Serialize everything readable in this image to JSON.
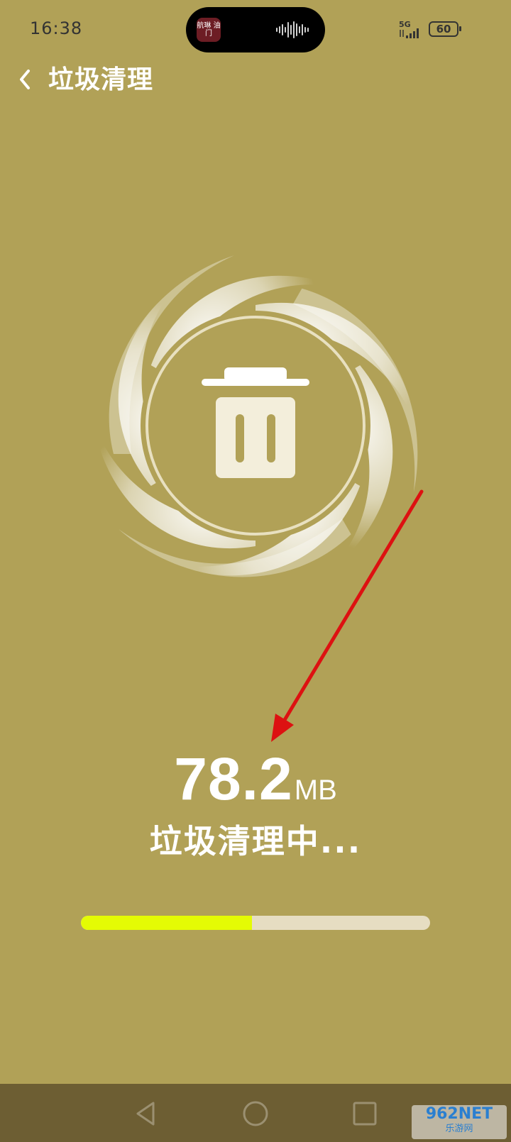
{
  "status_bar": {
    "time": "16:38",
    "network": "5G",
    "battery": "60",
    "island_app_label": "航琳 油门"
  },
  "header": {
    "back_icon": "chevron-left-icon",
    "title": "垃圾清理"
  },
  "cleaner": {
    "icon": "trash-can-icon",
    "size_value": "78.2",
    "size_unit": "MB",
    "status_text": "垃圾清理中...",
    "progress": 0.49
  },
  "nav_bar": {
    "back_icon": "triangle-back-icon",
    "home_icon": "circle-home-icon",
    "recents_icon": "square-recents-icon"
  },
  "watermark": {
    "main": "962NET",
    "sub": "乐游网"
  },
  "colors": {
    "background": "#b1a157",
    "progress_fill": "#e4fb04",
    "progress_track": "#e6ddc2",
    "nav_bar": "#6d5e33",
    "annotation_arrow": "#dd1111"
  }
}
